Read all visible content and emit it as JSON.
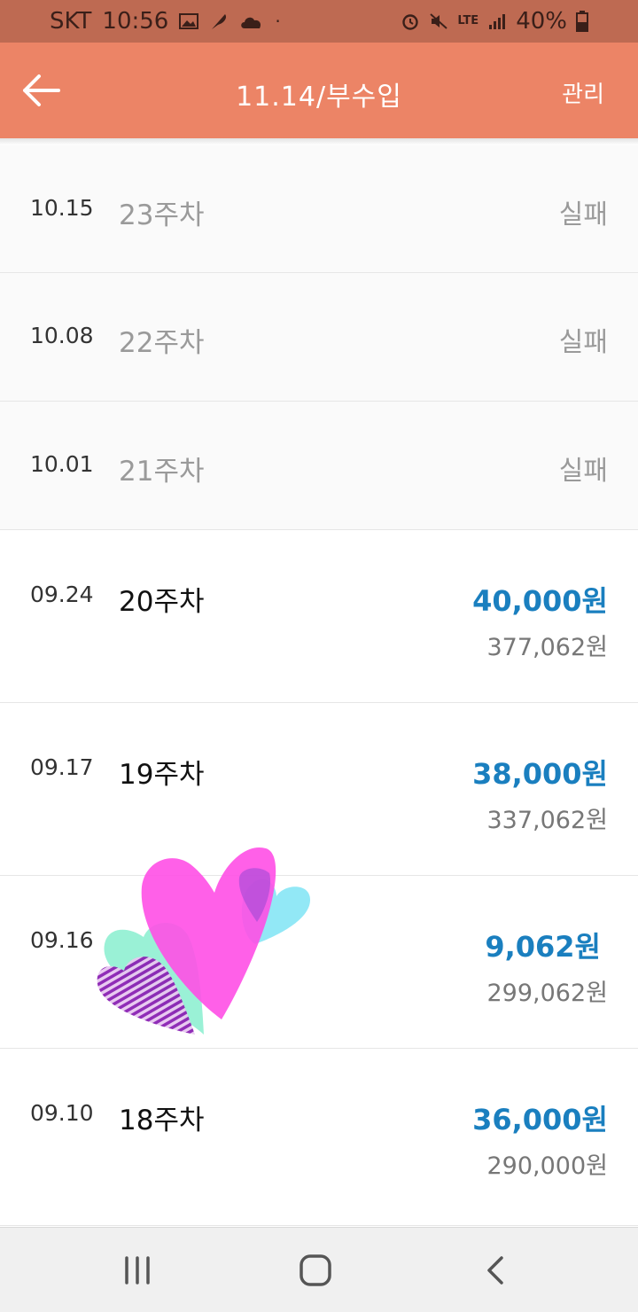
{
  "status_bar": {
    "carrier": "SKT",
    "time": "10:56",
    "network": "LTE",
    "battery": "40%",
    "left_icons": [
      "image-icon",
      "feather-icon",
      "cloud-icon",
      "dot-icon"
    ],
    "right_icons": [
      "alarm-icon",
      "mute-icon",
      "lte-icon",
      "signal-icon",
      "battery-icon"
    ]
  },
  "app_bar": {
    "title": "11.14/부수입",
    "manage_label": "관리",
    "back_icon": "arrow-left-icon"
  },
  "entries": [
    {
      "date": "10.15",
      "week": "23주차",
      "status": "실패"
    },
    {
      "date": "10.08",
      "week": "22주차",
      "status": "실패"
    },
    {
      "date": "10.01",
      "week": "21주차",
      "status": "실패"
    },
    {
      "date": "09.24",
      "week": "20주차",
      "amount": "40,000원",
      "total": "377,062원"
    },
    {
      "date": "09.17",
      "week": "19주차",
      "amount": "38,000원",
      "total": "337,062원"
    },
    {
      "date": "09.16",
      "week": "",
      "amount": "9,062원",
      "total": "299,062원"
    },
    {
      "date": "09.10",
      "week": "18주차",
      "amount": "36,000원",
      "total": "290,000원"
    }
  ],
  "colors": {
    "status_bar": "#be6a52",
    "app_bar": "#ec8466",
    "amount": "#1a7fbf",
    "fail_text": "#9a9a9a"
  },
  "nav_bar": {
    "icons": [
      "recent-apps-icon",
      "home-icon",
      "back-icon"
    ]
  }
}
